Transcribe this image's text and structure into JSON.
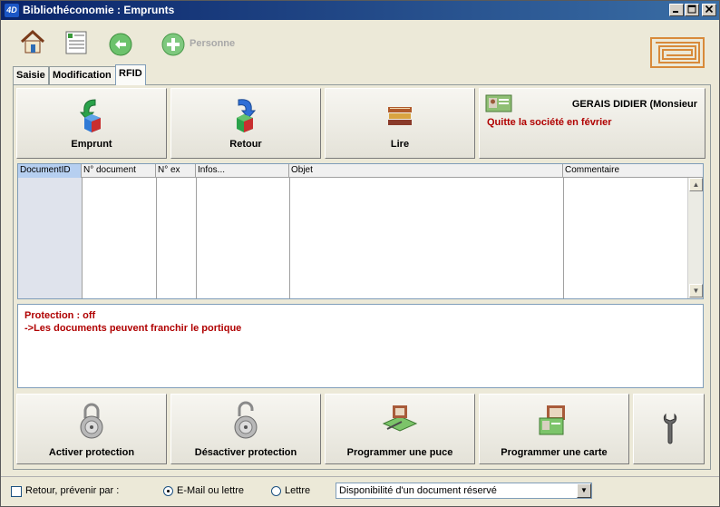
{
  "window": {
    "app_logo": "4D",
    "title": "Bibliothéconomie : Emprunts",
    "controls": [
      "minimize-icon",
      "maximize-icon",
      "close-icon"
    ]
  },
  "toolbar": {
    "icons": [
      "home-icon",
      "list-icon",
      "back-arrow-icon",
      "add-person-icon"
    ],
    "person_label": "Personne",
    "brand_logo": "maze-logo"
  },
  "tabs": [
    {
      "label": "Saisie"
    },
    {
      "label": "Modification"
    },
    {
      "label": "RFID",
      "active": true
    }
  ],
  "actions": {
    "emprunt": "Emprunt",
    "retour": "Retour",
    "lire": "Lire"
  },
  "person": {
    "name": "GERAIS DIDIER (Monsieur",
    "note": "Quitte la société en février",
    "icon": "id-card-icon"
  },
  "grid": {
    "columns": [
      "DocumentID",
      "N° document",
      "N° ex",
      "Infos...",
      "Objet",
      "Commentaire"
    ],
    "selected_column": "DocumentID",
    "rows": []
  },
  "message": {
    "line1": "Protection : off",
    "line2": " ->Les documents peuvent franchir le portique",
    "color": "#b00000"
  },
  "bottom_actions": {
    "activate": "Activer protection",
    "deactivate": "Désactiver protection",
    "program_chip": "Programmer une puce",
    "program_card": "Programmer une carte",
    "settings_icon": "wrench-icon"
  },
  "footer": {
    "notify_label": "Retour, prévenir par :",
    "notify_checked": false,
    "option_email": "E-Mail ou lettre",
    "option_letter": "Lettre",
    "selected_option": "email",
    "dropdown_value": "Disponibilité d'un document réservé"
  }
}
